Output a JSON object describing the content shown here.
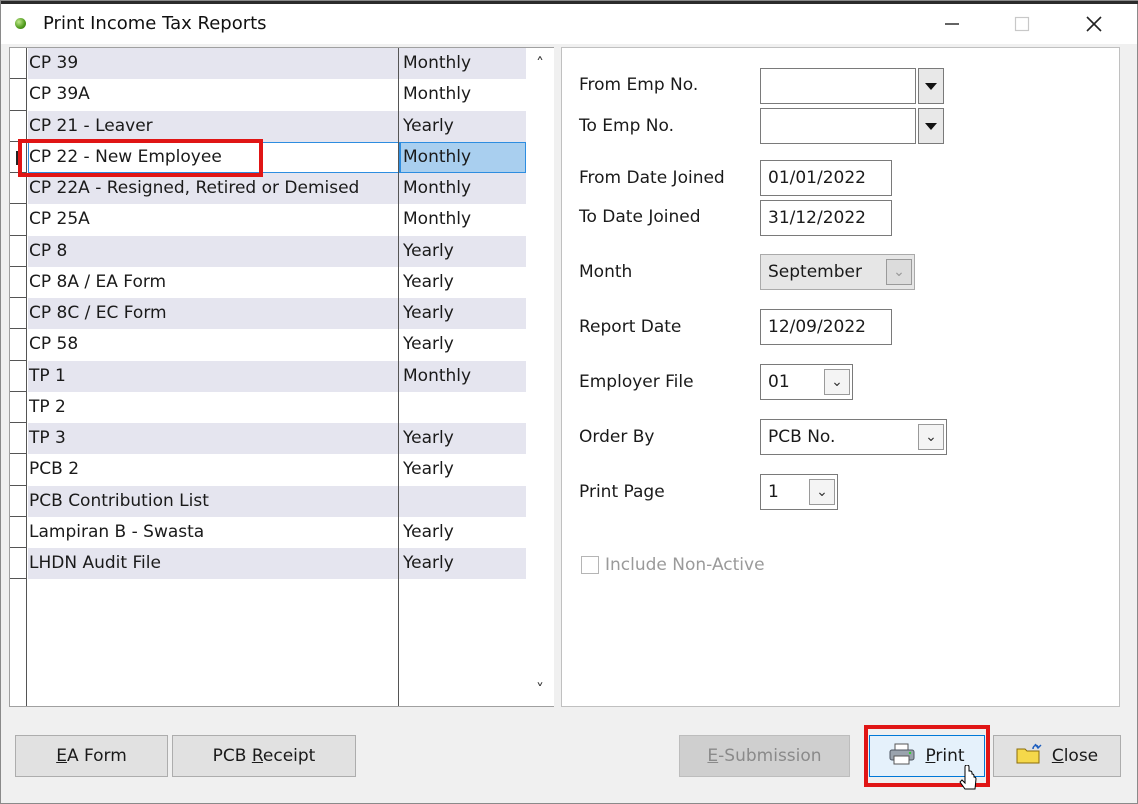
{
  "window": {
    "title": "Print Income Tax Reports"
  },
  "reports": [
    {
      "name": "CP 39",
      "frequency": "Monthly"
    },
    {
      "name": "CP 39A",
      "frequency": "Monthly"
    },
    {
      "name": "CP 21 - Leaver",
      "frequency": "Yearly"
    },
    {
      "name": "CP 22 - New Employee",
      "frequency": "Monthly"
    },
    {
      "name": "CP 22A - Resigned, Retired or Demised",
      "frequency": "Monthly"
    },
    {
      "name": "CP 25A",
      "frequency": "Monthly"
    },
    {
      "name": "CP 8",
      "frequency": "Yearly"
    },
    {
      "name": "CP 8A / EA Form",
      "frequency": "Yearly"
    },
    {
      "name": "CP 8C / EC Form",
      "frequency": "Yearly"
    },
    {
      "name": "CP 58",
      "frequency": "Yearly"
    },
    {
      "name": "TP 1",
      "frequency": "Monthly"
    },
    {
      "name": "TP 2",
      "frequency": ""
    },
    {
      "name": "TP 3",
      "frequency": "Yearly"
    },
    {
      "name": "PCB 2",
      "frequency": "Yearly"
    },
    {
      "name": "PCB Contribution List",
      "frequency": ""
    },
    {
      "name": "Lampiran B - Swasta",
      "frequency": "Yearly"
    },
    {
      "name": "LHDN Audit File",
      "frequency": "Yearly"
    }
  ],
  "selected_report": "CP 22 - New Employee",
  "form": {
    "from_emp_label": "From Emp No.",
    "from_emp_value": "",
    "to_emp_label": "To Emp No.",
    "to_emp_value": "",
    "from_date_label": "From Date Joined",
    "from_date_value": "01/01/2022",
    "to_date_label": "To Date Joined",
    "to_date_value": "31/12/2022",
    "month_label": "Month",
    "month_value": "September",
    "report_date_label": "Report Date",
    "report_date_value": "12/09/2022",
    "employer_file_label": "Employer File",
    "employer_file_value": "01",
    "order_by_label": "Order By",
    "order_by_value": "PCB No.",
    "print_page_label": "Print Page",
    "print_page_value": "1",
    "include_non_active_label": "Include Non-Active",
    "include_non_active_checked": false
  },
  "buttons": {
    "ea_form": {
      "accel": "E",
      "rest": "A Form"
    },
    "pcb_receipt": {
      "pre": "PCB ",
      "accel": "R",
      "rest": "eceipt"
    },
    "e_submission": {
      "accel": "E",
      "rest": "-Submission"
    },
    "print": {
      "accel": "P",
      "rest": "rint"
    },
    "close": {
      "accel": "C",
      "rest": "lose"
    }
  },
  "icons": [
    "minimize-icon",
    "maximize-icon",
    "close-icon",
    "printer-icon",
    "folder-close-icon",
    "scroll-up-icon",
    "scroll-down-icon",
    "dropdown-arrow-icon",
    "chevron-down-icon"
  ]
}
